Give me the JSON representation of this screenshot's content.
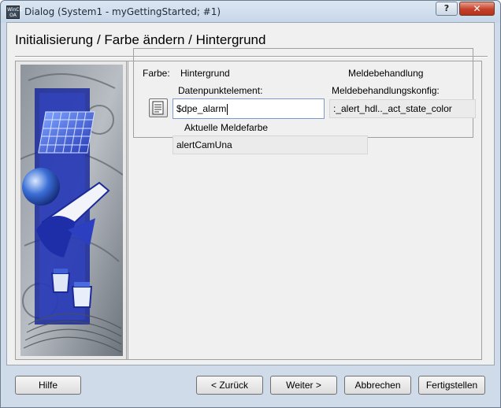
{
  "window": {
    "title": "Dialog (System1 - myGettingStarted; #1)",
    "app_icon_text": "WinCC OA",
    "help_label": "?",
    "close_label": "✕"
  },
  "page": {
    "title": "Initialisierung / Farbe ändern / Hintergrund"
  },
  "panel": {
    "farbe_label": "Farbe:",
    "farbe_value": "Hintergrund",
    "meldebehandlung_label": "Meldebehandlung",
    "datenpunkt_label": "Datenpunktelement:",
    "datenpunkt_value": "$dpe_alarm",
    "konfig_label": "Meldebehandlungskonfig:",
    "konfig_value": ":_alert_hdl.._act_state_color",
    "meldefarbe_label": "Aktuelle Meldefarbe",
    "meldefarbe_value": "alertCamUna"
  },
  "footer": {
    "hilfe": "Hilfe",
    "zurueck": "< Zurück",
    "weiter": "Weiter >",
    "abbrechen": "Abbrechen",
    "fertigstellen": "Fertigstellen"
  }
}
